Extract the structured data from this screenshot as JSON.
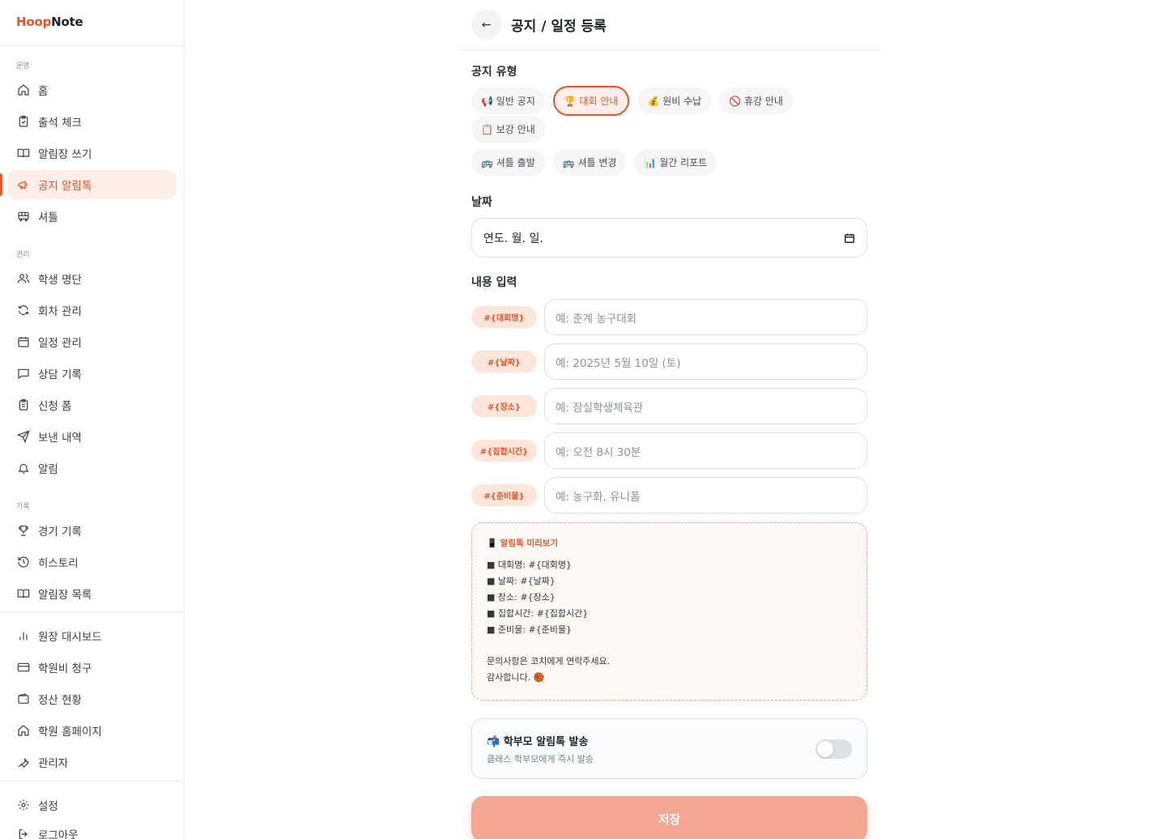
{
  "app": {
    "logo_part1": "Hoop",
    "logo_part2": "Note"
  },
  "sidebar": {
    "sections": [
      {
        "label": "운영",
        "items": [
          {
            "label": "홈",
            "icon": "home-icon"
          },
          {
            "label": "출석 체크",
            "icon": "clipboard-check-icon"
          },
          {
            "label": "알림장 쓰기",
            "icon": "book-open-icon"
          },
          {
            "label": "공지 알림톡",
            "icon": "megaphone-icon",
            "active": true
          },
          {
            "label": "셔틀",
            "icon": "bus-icon"
          }
        ]
      },
      {
        "label": "관리",
        "items": [
          {
            "label": "학생 명단",
            "icon": "users-icon"
          },
          {
            "label": "회차 관리",
            "icon": "refresh-icon"
          },
          {
            "label": "일정 관리",
            "icon": "calendar-icon"
          },
          {
            "label": "상담 기록",
            "icon": "message-square-icon"
          },
          {
            "label": "신청 폼",
            "icon": "clipboard-list-icon"
          },
          {
            "label": "보낸 내역",
            "icon": "send-icon"
          },
          {
            "label": "알림",
            "icon": "bell-icon"
          }
        ]
      },
      {
        "label": "기록",
        "items": [
          {
            "label": "경기 기록",
            "icon": "trophy-icon"
          },
          {
            "label": "히스토리",
            "icon": "history-icon"
          },
          {
            "label": "알림장 목록",
            "icon": "book-open-icon"
          }
        ]
      }
    ],
    "admin_items": [
      {
        "label": "원장 대시보드",
        "icon": "bar-chart-icon"
      },
      {
        "label": "학원비 청구",
        "icon": "credit-card-icon"
      },
      {
        "label": "정산 현황",
        "icon": "wallet-icon"
      },
      {
        "label": "학원 홈페이지",
        "icon": "home-icon"
      },
      {
        "label": "관리자",
        "icon": "wrench-icon"
      }
    ],
    "footer_items": [
      {
        "label": "설정",
        "icon": "gear-icon"
      },
      {
        "label": "로그아웃",
        "icon": "logout-icon"
      }
    ],
    "accent": "#e8542b"
  },
  "header": {
    "back_glyph": "←",
    "title": "공지 / 일정 등록"
  },
  "form": {
    "type_label": "공지 유형",
    "types": [
      {
        "label": "📢 일반 공지"
      },
      {
        "label": "🏆 대회 안내",
        "selected": true
      },
      {
        "label": "💰 원비 수납"
      },
      {
        "label": "🚫 휴강 안내"
      },
      {
        "label": "📋 보강 안내"
      },
      {
        "label": "🚌 셔틀 출발"
      },
      {
        "label": "🚌 셔틀 변경"
      },
      {
        "label": "📊 월간 리포트"
      }
    ],
    "date_label": "날짜",
    "date_value": "연도. 월. 일.",
    "content_label": "내용 입력",
    "fields": [
      {
        "tag": "#{대회명}",
        "placeholder": "예: 춘계 농구대회"
      },
      {
        "tag": "#{날짜}",
        "placeholder": "예: 2025년 5월 10일 (토)"
      },
      {
        "tag": "#{장소}",
        "placeholder": "예: 잠실학생체육관"
      },
      {
        "tag": "#{집합시간}",
        "placeholder": "예: 오전 8시 30분"
      },
      {
        "tag": "#{준비물}",
        "placeholder": "예: 농구화, 유니폼"
      }
    ],
    "preview": {
      "title": "📱 알림톡 미리보기",
      "lines": [
        "■ 대회명: #{대회명}",
        "■ 날짜: #{날짜}",
        "■ 장소: #{장소}",
        "■ 집합시간: #{집합시간}",
        "■ 준비물: #{준비물}"
      ],
      "footer_lines": [
        "문의사항은 코치에게 연락주세요.",
        "감사합니다. 🏀"
      ]
    },
    "toggle": {
      "title": "📬 학부모 알림톡 발송",
      "subtitle": "클래스 학부모에게 즉시 발송",
      "enabled": false
    },
    "save_label": "저장"
  }
}
